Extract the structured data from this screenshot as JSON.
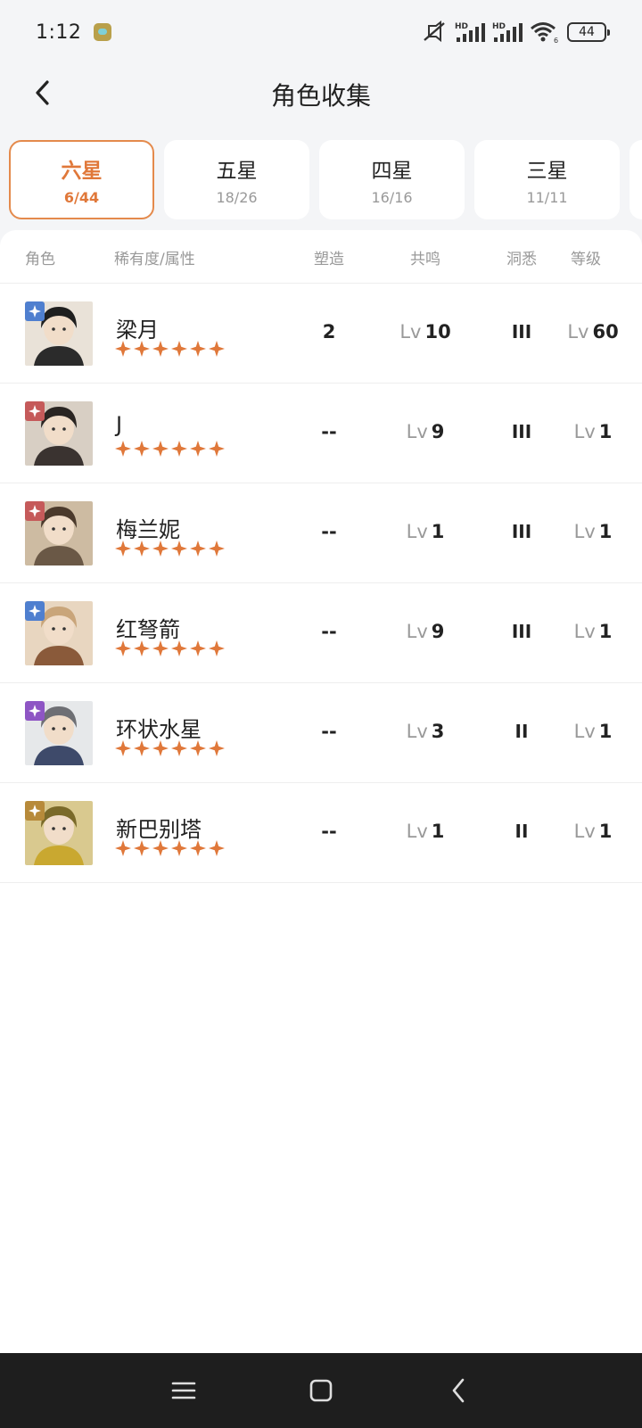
{
  "status": {
    "time": "1:12",
    "battery": "44",
    "network_label": "HD"
  },
  "header": {
    "title": "角色收集"
  },
  "tabs": [
    {
      "label": "六星",
      "count": "6/44",
      "active": true
    },
    {
      "label": "五星",
      "count": "18/26",
      "active": false
    },
    {
      "label": "四星",
      "count": "16/16",
      "active": false
    },
    {
      "label": "三星",
      "count": "11/11",
      "active": false
    }
  ],
  "columns": {
    "role": "角色",
    "rarity": "稀有度/属性",
    "shaping": "塑造",
    "resonance": "共鸣",
    "insight": "洞悉",
    "level": "等级"
  },
  "level_prefix": "Lv",
  "characters": [
    {
      "name": "梁月",
      "stars": 6,
      "element": "blue-star-icon",
      "element_color": "#4f7fcf",
      "shaping": "2",
      "resonance": "10",
      "insight": "III",
      "level": "60"
    },
    {
      "name": "J",
      "stars": 6,
      "element": "red-wave-icon",
      "element_color": "#c55a5a",
      "shaping": "--",
      "resonance": "9",
      "insight": "III",
      "level": "1"
    },
    {
      "name": "梅兰妮",
      "stars": 6,
      "element": "red-wave-icon",
      "element_color": "#c55a5a",
      "shaping": "--",
      "resonance": "1",
      "insight": "III",
      "level": "1"
    },
    {
      "name": "红弩箭",
      "stars": 6,
      "element": "blue-star-icon",
      "element_color": "#4f7fcf",
      "shaping": "--",
      "resonance": "9",
      "insight": "III",
      "level": "1"
    },
    {
      "name": "环状水星",
      "stars": 6,
      "element": "purple-ring-icon",
      "element_color": "#8e55c4",
      "shaping": "--",
      "resonance": "3",
      "insight": "II",
      "level": "1"
    },
    {
      "name": "新巴别塔",
      "stars": 6,
      "element": "gold-tower-icon",
      "element_color": "#b78a3a",
      "shaping": "--",
      "resonance": "1",
      "insight": "II",
      "level": "1"
    }
  ],
  "colors": {
    "accent": "#e0783a",
    "star": "#e0783a",
    "muted": "#999999"
  }
}
